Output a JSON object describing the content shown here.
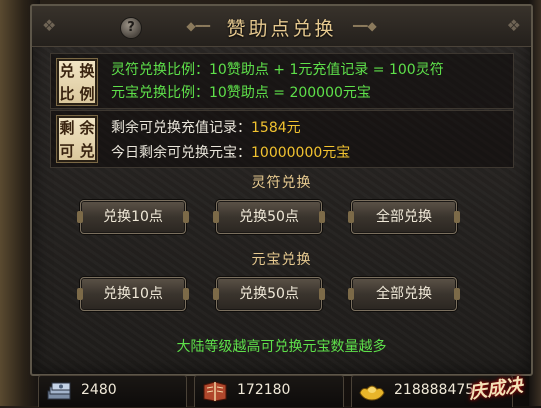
{
  "title": "赞助点兑换",
  "help_icon_glyph": "?",
  "ratio_tag": [
    "兑",
    "换",
    "比",
    "例"
  ],
  "ratio_lines": [
    "灵符兑换比例：10赞助点 + 1元充值记录 = 100灵符",
    "元宝兑换比例：10赞助点 = 200000元宝"
  ],
  "remain_tag": [
    "剩",
    "余",
    "可",
    "兑"
  ],
  "remain_lines": [
    {
      "label": "剩余可兑换充值记录：",
      "value": "1584元"
    },
    {
      "label": "今日剩余可兑换元宝：",
      "value": "10000000元宝"
    }
  ],
  "lingfu_section": {
    "title": "灵符兑换",
    "buttons": [
      "兑换10点",
      "兑换50点",
      "全部兑换"
    ]
  },
  "yuanbao_section": {
    "title": "元宝兑换",
    "buttons": [
      "兑换10点",
      "兑换50点",
      "全部兑换"
    ]
  },
  "footer_note": "大陆等级越高可兑换元宝数量越多",
  "currencies": [
    {
      "icon": "money-stack-icon",
      "value": "2480"
    },
    {
      "icon": "book-icon",
      "value": "172180"
    },
    {
      "icon": "gold-ingot-icon",
      "value": "218888475"
    }
  ],
  "logo_text": "庆成决",
  "colors": {
    "accent_gold": "#f2c330",
    "green_text": "#5ee04a",
    "title_gold": "#e6c98f"
  }
}
